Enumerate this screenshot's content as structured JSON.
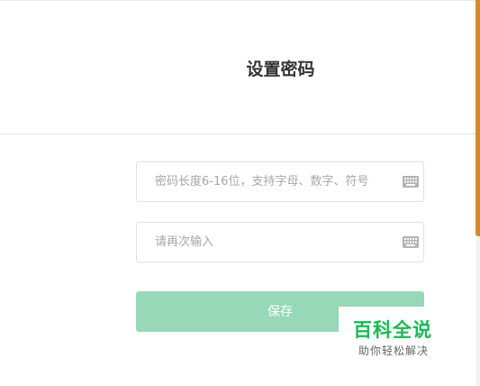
{
  "header": {
    "title": "设置密码"
  },
  "form": {
    "password": {
      "placeholder": "密码长度6-16位，支持字母、数字、符号",
      "value": ""
    },
    "confirm": {
      "placeholder": "请再次输入",
      "value": ""
    },
    "save_label": "保存"
  },
  "watermark": {
    "title": "百科全说",
    "subtitle": "助你轻松解决"
  },
  "colors": {
    "accent_bar": "#d38a2c",
    "save_button": "#97d8b9",
    "watermark_green": "#19b955"
  },
  "icons": {
    "keyboard": "keyboard-icon"
  }
}
